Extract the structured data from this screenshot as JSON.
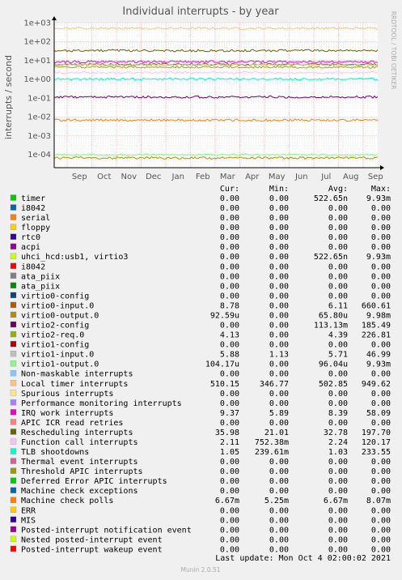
{
  "chart_data": {
    "type": "line",
    "title": "Individual interrupts - by year",
    "ylabel": "interrupts / second",
    "xlabel": "",
    "yscale": "log",
    "ylim": [
      2e-05,
      1000
    ],
    "grid": true,
    "y_ticks": [
      {
        "value": 1000,
        "label": "1e+03"
      },
      {
        "value": 100,
        "label": "1e+02"
      },
      {
        "value": 10,
        "label": "1e+01"
      },
      {
        "value": 1,
        "label": "1e+00"
      },
      {
        "value": 0.1,
        "label": "1e-01"
      },
      {
        "value": 0.01,
        "label": "1e-02"
      },
      {
        "value": 0.001,
        "label": "1e-03"
      },
      {
        "value": 0.0001,
        "label": "1e-04"
      }
    ],
    "x_ticks": [
      "Sep",
      "Oct",
      "Nov",
      "Dec",
      "Jan",
      "Feb",
      "Mar",
      "Apr",
      "May",
      "Jun",
      "Jul",
      "Aug",
      "Sep"
    ],
    "legend_position": "bottom",
    "columns": [
      "Cur:",
      "Min:",
      "Avg:",
      "Max:"
    ],
    "series": [
      {
        "name": "timer",
        "color": "#00cc00",
        "cur": "0.00",
        "min": "0.00",
        "avg": "522.65n",
        "max": "9.93m"
      },
      {
        "name": "i8042",
        "color": "#0066b3",
        "cur": "0.00",
        "min": "0.00",
        "avg": "0.00",
        "max": "0.00"
      },
      {
        "name": "serial",
        "color": "#ff8000",
        "cur": "0.00",
        "min": "0.00",
        "avg": "0.00",
        "max": "0.00"
      },
      {
        "name": "floppy",
        "color": "#ffcc00",
        "cur": "0.00",
        "min": "0.00",
        "avg": "0.00",
        "max": "0.00"
      },
      {
        "name": "rtc0",
        "color": "#330099",
        "cur": "0.00",
        "min": "0.00",
        "avg": "0.00",
        "max": "0.00"
      },
      {
        "name": "acpi",
        "color": "#990099",
        "cur": "0.00",
        "min": "0.00",
        "avg": "0.00",
        "max": "0.00"
      },
      {
        "name": "uhci_hcd:usb1, virtio3",
        "color": "#ccff00",
        "cur": "0.00",
        "min": "0.00",
        "avg": "522.65n",
        "max": "9.93m"
      },
      {
        "name": "i8042",
        "color": "#ff0000",
        "cur": "0.00",
        "min": "0.00",
        "avg": "0.00",
        "max": "0.00"
      },
      {
        "name": "ata_piix",
        "color": "#808080",
        "cur": "0.00",
        "min": "0.00",
        "avg": "0.00",
        "max": "0.00"
      },
      {
        "name": "ata_piix",
        "color": "#008f00",
        "cur": "0.00",
        "min": "0.00",
        "avg": "0.00",
        "max": "0.00"
      },
      {
        "name": "virtio0-config",
        "color": "#00487d",
        "cur": "0.00",
        "min": "0.00",
        "avg": "0.00",
        "max": "0.00"
      },
      {
        "name": "virtio0-input.0",
        "color": "#b35a00",
        "cur": "8.78",
        "min": "0.00",
        "avg": "6.11",
        "max": "660.61"
      },
      {
        "name": "virtio0-output.0",
        "color": "#b38f00",
        "cur": "92.59u",
        "min": "0.00",
        "avg": "65.80u",
        "max": "9.98m"
      },
      {
        "name": "virtio2-config",
        "color": "#6b006b",
        "cur": "0.00",
        "min": "0.00",
        "avg": "113.13m",
        "max": "185.49"
      },
      {
        "name": "virtio2-req.0",
        "color": "#8fb300",
        "cur": "4.13",
        "min": "0.00",
        "avg": "4.39",
        "max": "226.81"
      },
      {
        "name": "virtio1-config",
        "color": "#b30000",
        "cur": "0.00",
        "min": "0.00",
        "avg": "0.00",
        "max": "0.00"
      },
      {
        "name": "virtio1-input.0",
        "color": "#bebebe",
        "cur": "5.88",
        "min": "1.13",
        "avg": "5.71",
        "max": "46.99"
      },
      {
        "name": "virtio1-output.0",
        "color": "#80ff80",
        "cur": "104.17u",
        "min": "0.00",
        "avg": "96.04u",
        "max": "9.93m"
      },
      {
        "name": "Non-maskable interrupts",
        "color": "#80c9ff",
        "cur": "0.00",
        "min": "0.00",
        "avg": "0.00",
        "max": "0.00"
      },
      {
        "name": "Local timer interrupts",
        "color": "#ffc080",
        "cur": "510.15",
        "min": "346.77",
        "avg": "502.85",
        "max": "949.62"
      },
      {
        "name": "Spurious interrupts",
        "color": "#ffe680",
        "cur": "0.00",
        "min": "0.00",
        "avg": "0.00",
        "max": "0.00"
      },
      {
        "name": "Performance monitoring interrupts",
        "color": "#aa80ff",
        "cur": "0.00",
        "min": "0.00",
        "avg": "0.00",
        "max": "0.00"
      },
      {
        "name": "IRQ work interrupts",
        "color": "#ee00cc",
        "cur": "9.37",
        "min": "5.89",
        "avg": "8.39",
        "max": "58.09"
      },
      {
        "name": "APIC ICR read retries",
        "color": "#ff8080",
        "cur": "0.00",
        "min": "0.00",
        "avg": "0.00",
        "max": "0.00"
      },
      {
        "name": "Rescheduling interrupts",
        "color": "#666600",
        "cur": "35.98",
        "min": "21.01",
        "avg": "32.78",
        "max": "197.70"
      },
      {
        "name": "Function call interrupts",
        "color": "#ffbfff",
        "cur": "2.11",
        "min": "752.38m",
        "avg": "2.24",
        "max": "120.17"
      },
      {
        "name": "TLB shootdowns",
        "color": "#00ffcc",
        "cur": "1.05",
        "min": "239.61m",
        "avg": "1.03",
        "max": "233.55"
      },
      {
        "name": "Thermal event interrupts",
        "color": "#cc6699",
        "cur": "0.00",
        "min": "0.00",
        "avg": "0.00",
        "max": "0.00"
      },
      {
        "name": "Threshold APIC interrupts",
        "color": "#999900",
        "cur": "0.00",
        "min": "0.00",
        "avg": "0.00",
        "max": "0.00"
      },
      {
        "name": "Deferred Error APIC interrupts",
        "color": "#00cc00",
        "cur": "0.00",
        "min": "0.00",
        "avg": "0.00",
        "max": "0.00"
      },
      {
        "name": "Machine check exceptions",
        "color": "#0066b3",
        "cur": "0.00",
        "min": "0.00",
        "avg": "0.00",
        "max": "0.00"
      },
      {
        "name": "Machine check polls",
        "color": "#ff8000",
        "cur": "6.67m",
        "min": "5.25m",
        "avg": "6.67m",
        "max": "8.07m"
      },
      {
        "name": "ERR",
        "color": "#ffcc00",
        "cur": "0.00",
        "min": "0.00",
        "avg": "0.00",
        "max": "0.00"
      },
      {
        "name": "MIS",
        "color": "#330099",
        "cur": "0.00",
        "min": "0.00",
        "avg": "0.00",
        "max": "0.00"
      },
      {
        "name": "Posted-interrupt notification event",
        "color": "#990099",
        "cur": "0.00",
        "min": "0.00",
        "avg": "0.00",
        "max": "0.00"
      },
      {
        "name": "Nested posted-interrupt event",
        "color": "#ccff00",
        "cur": "0.00",
        "min": "0.00",
        "avg": "0.00",
        "max": "0.00"
      },
      {
        "name": "Posted-interrupt wakeup event",
        "color": "#ff0000",
        "cur": "0.00",
        "min": "0.00",
        "avg": "0.00",
        "max": "0.00"
      }
    ]
  },
  "side_label": "RRDTOOL / TOBI OETIKER",
  "last_update": "Last update: Mon Oct  4 02:00:02 2021",
  "footer": "Munin 2.0.51",
  "colors": {
    "background": "#f0f0f0",
    "plot_background": "#ffffff",
    "grid_major": "#e2a0a0",
    "grid_minor": "#dddddd"
  }
}
